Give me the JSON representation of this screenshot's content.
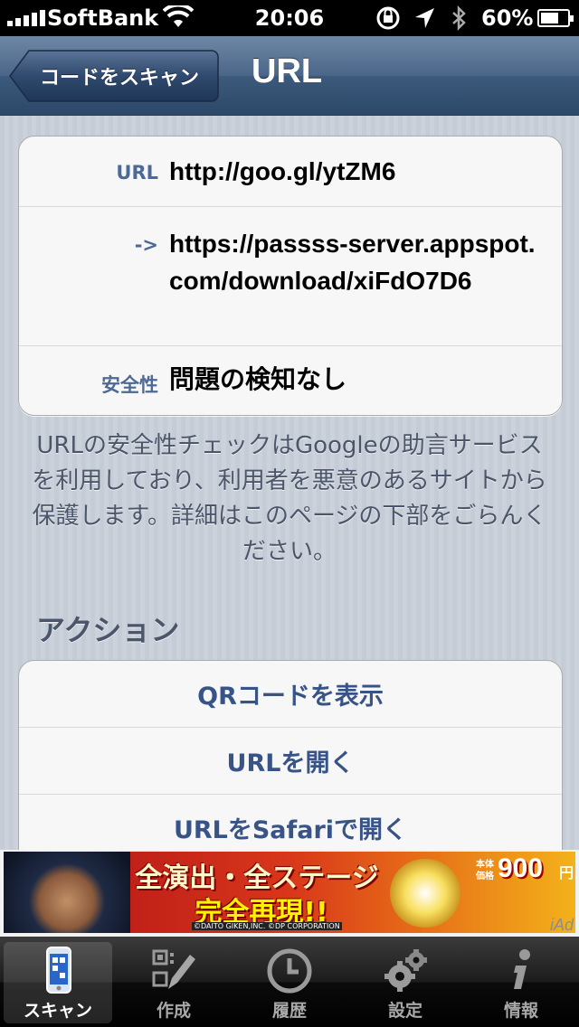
{
  "status_bar": {
    "carrier": "SoftBank",
    "time": "20:06",
    "battery": "60%"
  },
  "nav": {
    "back_label": "コードをスキャン",
    "title": "URL"
  },
  "details": {
    "url_label": "URL",
    "url_value": "http://goo.gl/ytZM6",
    "redirect_label": "->",
    "redirect_value": "https://passss-server.appspot.com/download/xiFdO7D6",
    "safety_label": "安全性",
    "safety_value": "問題の検知なし"
  },
  "info_text": "URLの安全性チェックはGoogleの助言サービスを利用しており、利用者を悪意のあるサイトから保護します。詳細はこのページの下部をごらんください。",
  "actions": {
    "title": "アクション",
    "items": [
      "QRコードを表示",
      "URLを開く",
      "URLをSafariで開く"
    ]
  },
  "ad": {
    "line1": "全演出・全ステージ",
    "line2": "完全再現!!",
    "copyright": "©DAITO GIKEN,INC. ©DP CORPORATION",
    "price_label_1": "本体",
    "price_label_2": "価格",
    "price": "900",
    "price_unit": "円",
    "badge": "iAd"
  },
  "tabs": [
    {
      "label": "スキャン",
      "icon": "phone-scan-icon",
      "active": true
    },
    {
      "label": "作成",
      "icon": "qr-pencil-icon",
      "active": false
    },
    {
      "label": "履歴",
      "icon": "clock-icon",
      "active": false
    },
    {
      "label": "設定",
      "icon": "gears-icon",
      "active": false
    },
    {
      "label": "情報",
      "icon": "info-icon",
      "active": false
    }
  ],
  "colors": {
    "navbar": "#4a6688",
    "label_blue": "#4c6a95",
    "action_blue": "#385487",
    "background": "#c8ccd4"
  }
}
